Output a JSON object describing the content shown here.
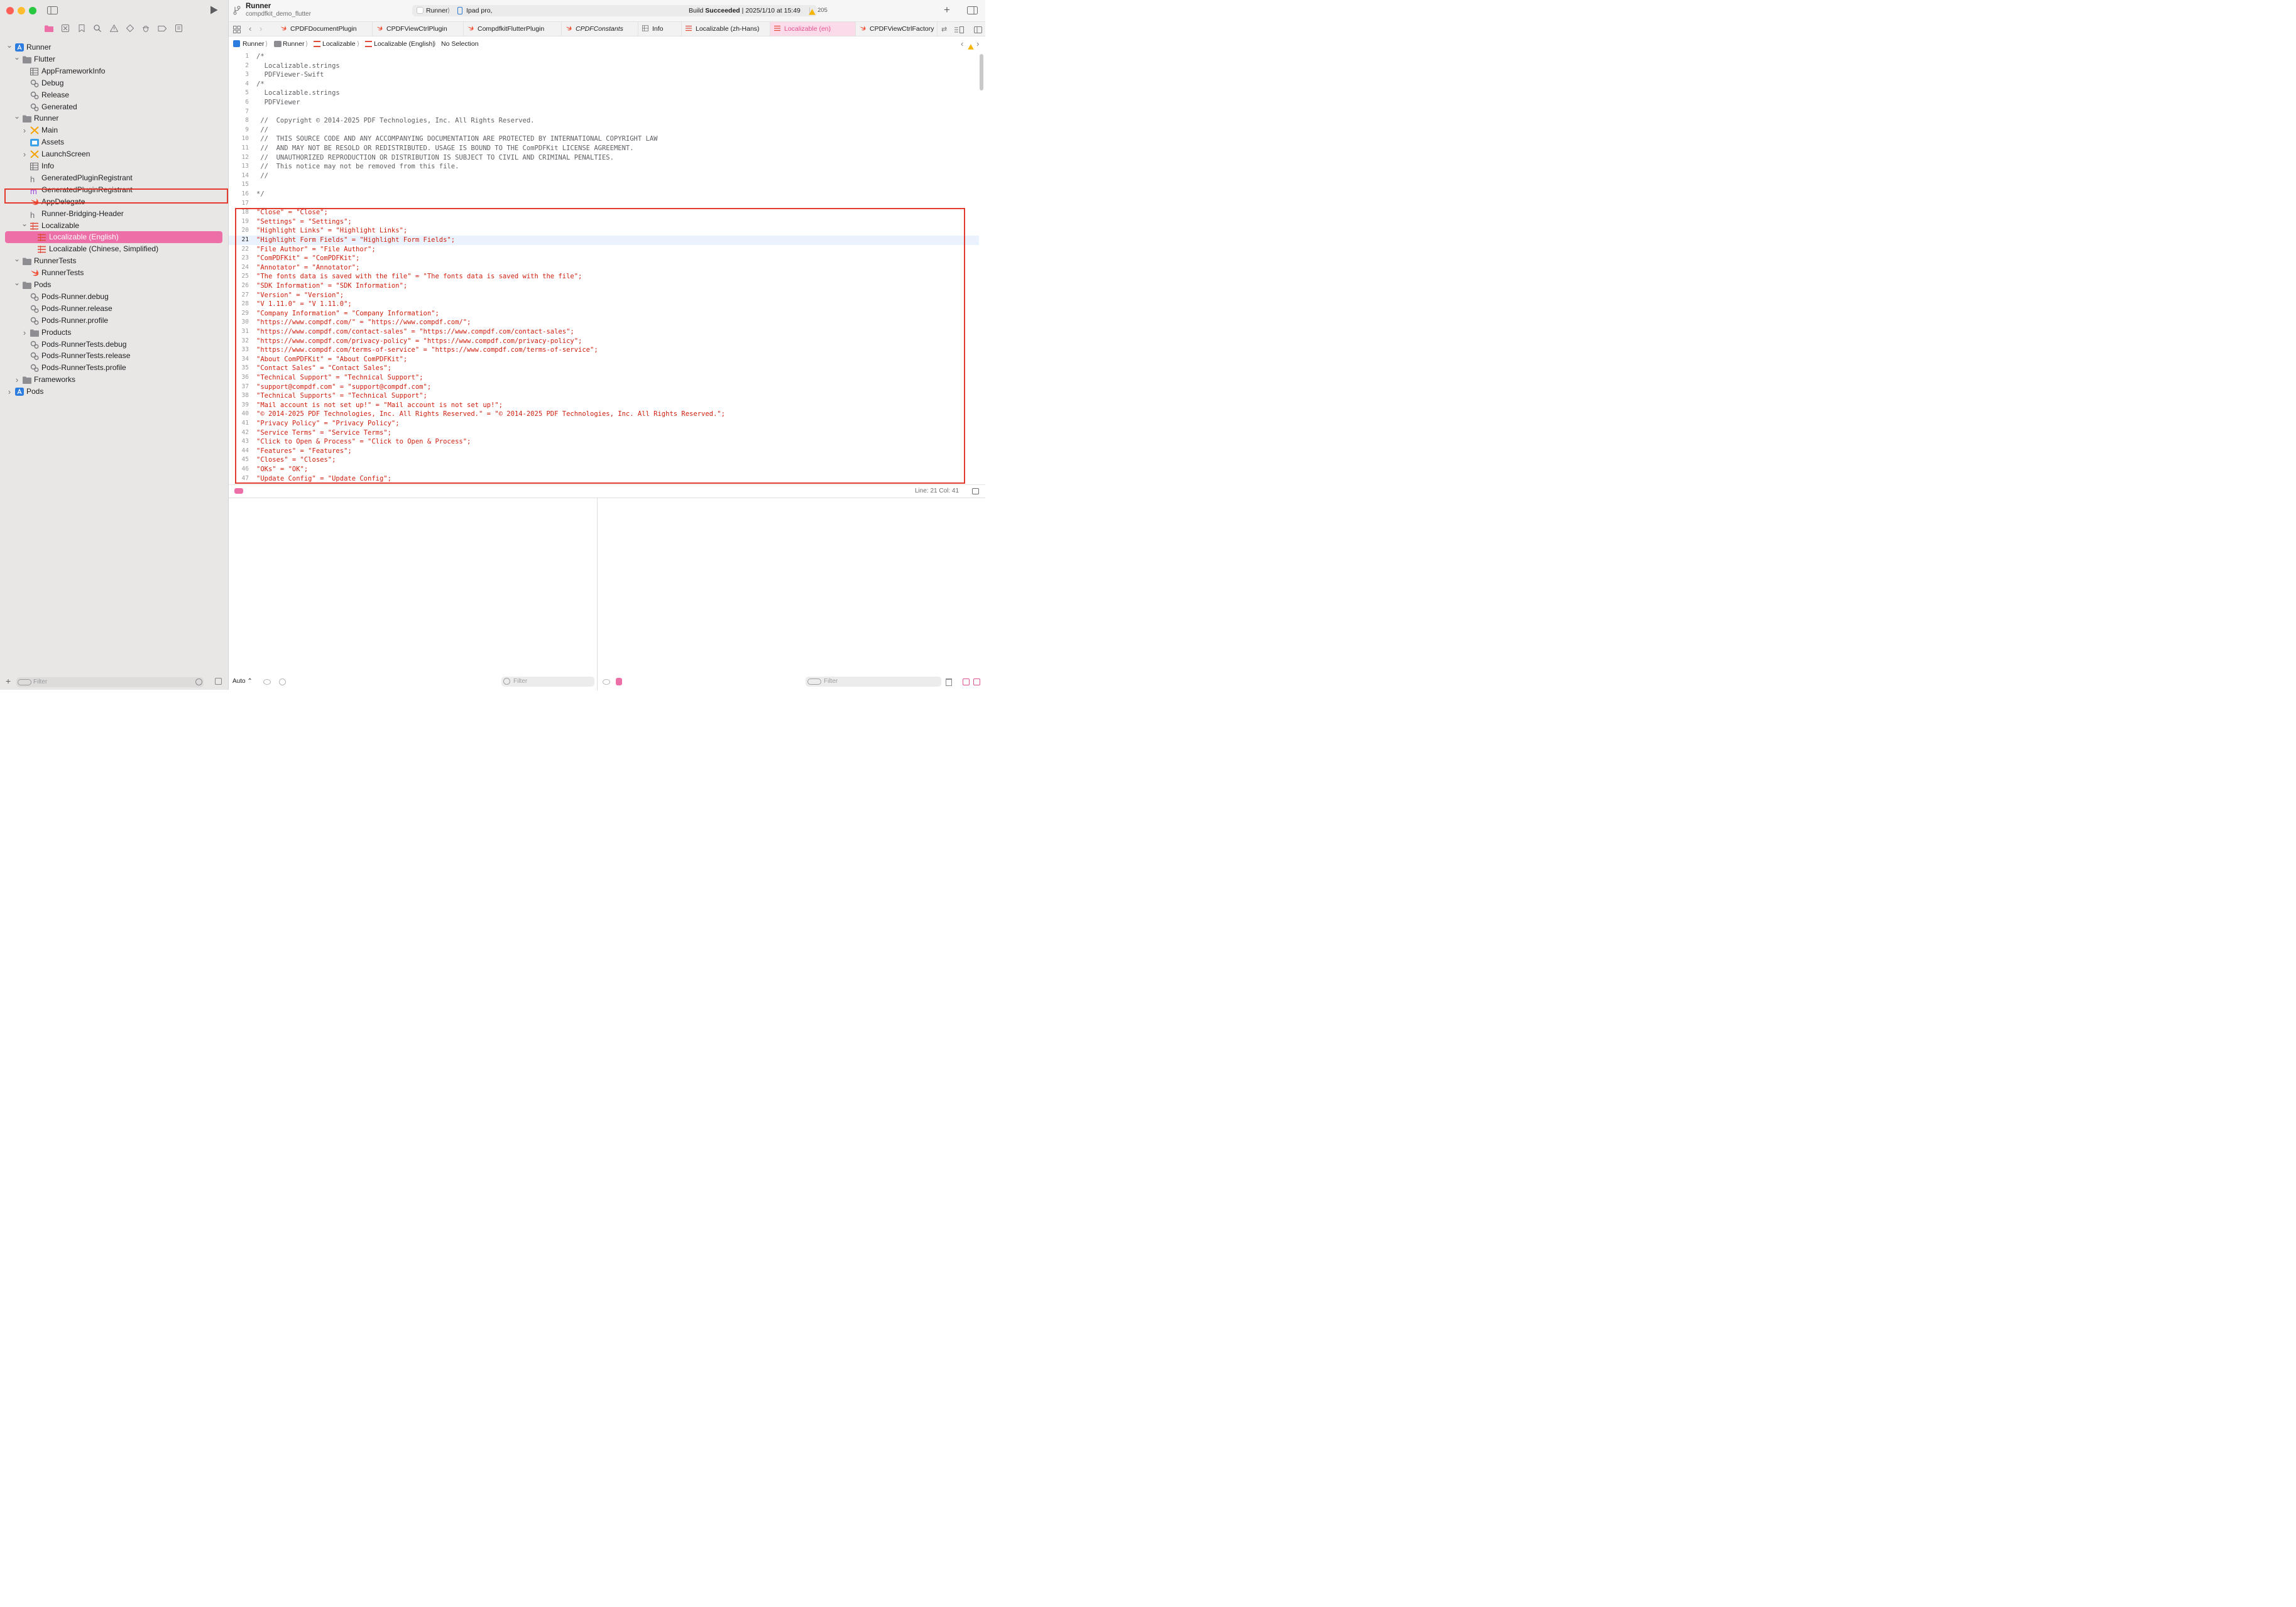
{
  "window": {
    "scheme_name": "Runner",
    "project_name": "compdfkit_demo_flutter",
    "destination_scheme": "Runner",
    "destination_device": "Ipad pro,",
    "build_status_prefix": "Build",
    "build_status_result": "Succeeded",
    "build_timestamp": "2025/1/10 at 15:49",
    "warning_count": "205"
  },
  "sidebar": {
    "filter_placeholder": "Filter",
    "tree": [
      {
        "label": "Runner",
        "icon": "xcode-project-icon"
      },
      {
        "label": "Flutter",
        "icon": "folder-icon"
      },
      {
        "label": "AppFrameworkInfo",
        "icon": "plist-icon"
      },
      {
        "label": "Debug",
        "icon": "xcconfig-icon"
      },
      {
        "label": "Release",
        "icon": "xcconfig-icon"
      },
      {
        "label": "Generated",
        "icon": "xcconfig-icon"
      },
      {
        "label": "Runner",
        "icon": "folder-icon"
      },
      {
        "label": "Main",
        "icon": "storyboard-icon"
      },
      {
        "label": "Assets",
        "icon": "asset-catalog-icon"
      },
      {
        "label": "LaunchScreen",
        "icon": "storyboard-icon"
      },
      {
        "label": "Info",
        "icon": "plist-icon"
      },
      {
        "label": "GeneratedPluginRegistrant",
        "icon": "header-file-icon"
      },
      {
        "label": "GeneratedPluginRegistrant",
        "icon": "objc-file-icon"
      },
      {
        "label": "AppDelegate",
        "icon": "swift-file-icon"
      },
      {
        "label": "Runner-Bridging-Header",
        "icon": "header-file-icon"
      },
      {
        "label": "Localizable",
        "icon": "strings-file-icon"
      },
      {
        "label": "Localizable (English)",
        "icon": "strings-file-icon"
      },
      {
        "label": "Localizable (Chinese, Simplified)",
        "icon": "strings-file-icon"
      },
      {
        "label": "RunnerTests",
        "icon": "folder-icon"
      },
      {
        "label": "RunnerTests",
        "icon": "swift-file-icon"
      },
      {
        "label": "Pods",
        "icon": "folder-icon"
      },
      {
        "label": "Pods-Runner.debug",
        "icon": "xcconfig-icon"
      },
      {
        "label": "Pods-Runner.release",
        "icon": "xcconfig-icon"
      },
      {
        "label": "Pods-Runner.profile",
        "icon": "xcconfig-icon"
      },
      {
        "label": "Products",
        "icon": "folder-icon"
      },
      {
        "label": "Pods-RunnerTests.debug",
        "icon": "xcconfig-icon"
      },
      {
        "label": "Pods-RunnerTests.release",
        "icon": "xcconfig-icon"
      },
      {
        "label": "Pods-RunnerTests.profile",
        "icon": "xcconfig-icon"
      },
      {
        "label": "Frameworks",
        "icon": "folder-icon"
      },
      {
        "label": "Pods",
        "icon": "xcode-project-icon"
      }
    ]
  },
  "tabs": [
    {
      "label": "CPDFDocumentPlugin",
      "icon": "swift-file-icon"
    },
    {
      "label": "CPDFViewCtrlPlugin",
      "icon": "swift-file-icon"
    },
    {
      "label": "CompdfkitFlutterPlugin",
      "icon": "swift-file-icon"
    },
    {
      "label": "CPDFConstants",
      "icon": "swift-file-icon"
    },
    {
      "label": "Info",
      "icon": "plist-icon"
    },
    {
      "label": "Localizable (zh-Hans)",
      "icon": "strings-file-icon"
    },
    {
      "label": "Localizable (en)",
      "icon": "strings-file-icon"
    },
    {
      "label": "CPDFViewCtrlFactory",
      "icon": "swift-file-icon"
    }
  ],
  "breadcrumb": [
    "Runner",
    "Runner",
    "Localizable",
    "Localizable (English)",
    "No Selection"
  ],
  "editor": {
    "lines": [
      {
        "n": "1",
        "text": "/*",
        "kind": "com"
      },
      {
        "n": "2",
        "text": "  Localizable.strings",
        "kind": "com"
      },
      {
        "n": "3",
        "text": "  PDFViewer-Swift",
        "kind": "com"
      },
      {
        "n": "4",
        "text": "/*",
        "kind": "com"
      },
      {
        "n": "5",
        "text": "  Localizable.strings",
        "kind": "com"
      },
      {
        "n": "6",
        "text": "  PDFViewer",
        "kind": "com"
      },
      {
        "n": "7",
        "text": "",
        "kind": "com"
      },
      {
        "n": "8",
        "text": " //  Copyright © 2014-2025 PDF Technologies, Inc. All Rights Reserved.",
        "kind": "com"
      },
      {
        "n": "9",
        "text": " //",
        "kind": "com"
      },
      {
        "n": "10",
        "text": " //  THIS SOURCE CODE AND ANY ACCOMPANYING DOCUMENTATION ARE PROTECTED BY INTERNATIONAL COPYRIGHT LAW",
        "kind": "com"
      },
      {
        "n": "11",
        "text": " //  AND MAY NOT BE RESOLD OR REDISTRIBUTED. USAGE IS BOUND TO THE ComPDFKit LICENSE AGREEMENT.",
        "kind": "com"
      },
      {
        "n": "12",
        "text": " //  UNAUTHORIZED REPRODUCTION OR DISTRIBUTION IS SUBJECT TO CIVIL AND CRIMINAL PENALTIES.",
        "kind": "com"
      },
      {
        "n": "13",
        "text": " //  This notice may not be removed from this file.",
        "kind": "com"
      },
      {
        "n": "14",
        "text": " //",
        "kind": "com"
      },
      {
        "n": "15",
        "text": "",
        "kind": "com"
      },
      {
        "n": "16",
        "text": "*/",
        "kind": "com"
      },
      {
        "n": "17",
        "text": "",
        "kind": "com"
      },
      {
        "n": "18",
        "text": "\"Close\" = \"Close\";",
        "kind": "str"
      },
      {
        "n": "19",
        "text": "\"Settings\" = \"Settings\";",
        "kind": "str"
      },
      {
        "n": "20",
        "text": "\"Highlight Links\" = \"Highlight Links\";",
        "kind": "str"
      },
      {
        "n": "21",
        "text": "\"Highlight Form Fields\" = \"Highlight Form Fields\";",
        "kind": "str"
      },
      {
        "n": "22",
        "text": "\"File Author\" = \"File Author\";",
        "kind": "str"
      },
      {
        "n": "23",
        "text": "\"ComPDFKit\" = \"ComPDFKit\";",
        "kind": "str"
      },
      {
        "n": "24",
        "text": "\"Annotator\" = \"Annotator\";",
        "kind": "str"
      },
      {
        "n": "25",
        "text": "\"The fonts data is saved with the file\" = \"The fonts data is saved with the file\";",
        "kind": "str"
      },
      {
        "n": "26",
        "text": "\"SDK Information\" = \"SDK Information\";",
        "kind": "str"
      },
      {
        "n": "27",
        "text": "\"Version\" = \"Version\";",
        "kind": "str"
      },
      {
        "n": "28",
        "text": "\"V 1.11.0\" = \"V 1.11.0\";",
        "kind": "str"
      },
      {
        "n": "29",
        "text": "\"Company Information\" = \"Company Information\";",
        "kind": "str"
      },
      {
        "n": "30",
        "text": "\"https://www.compdf.com/\" = \"https://www.compdf.com/\";",
        "kind": "str"
      },
      {
        "n": "31",
        "text": "\"https://www.compdf.com/contact-sales\" = \"https://www.compdf.com/contact-sales\";",
        "kind": "str"
      },
      {
        "n": "32",
        "text": "\"https://www.compdf.com/privacy-policy\" = \"https://www.compdf.com/privacy-policy\";",
        "kind": "str"
      },
      {
        "n": "33",
        "text": "\"https://www.compdf.com/terms-of-service\" = \"https://www.compdf.com/terms-of-service\";",
        "kind": "str"
      },
      {
        "n": "34",
        "text": "\"About ComPDFKit\" = \"About ComPDFKit\";",
        "kind": "str"
      },
      {
        "n": "35",
        "text": "\"Contact Sales\" = \"Contact Sales\";",
        "kind": "str"
      },
      {
        "n": "36",
        "text": "\"Technical Support\" = \"Technical Support\";",
        "kind": "str"
      },
      {
        "n": "37",
        "text": "\"support@compdf.com\" = \"support@compdf.com\";",
        "kind": "str"
      },
      {
        "n": "38",
        "text": "\"Technical Supports\" = \"Technical Support\";",
        "kind": "str"
      },
      {
        "n": "39",
        "text": "\"Mail account is not set up!\" = \"Mail account is not set up!\";",
        "kind": "str"
      },
      {
        "n": "40",
        "text": "\"© 2014-2025 PDF Technologies, Inc. All Rights Reserved.\" = \"© 2014-2025 PDF Technologies, Inc. All Rights Reserved.\";",
        "kind": "str"
      },
      {
        "n": "41",
        "text": "\"Privacy Policy\" = \"Privacy Policy\";",
        "kind": "str"
      },
      {
        "n": "42",
        "text": "\"Service Terms\" = \"Service Terms\";",
        "kind": "str"
      },
      {
        "n": "43",
        "text": "\"Click to Open & Process\" = \"Click to Open & Process\";",
        "kind": "str"
      },
      {
        "n": "44",
        "text": "\"Features\" = \"Features\";",
        "kind": "str"
      },
      {
        "n": "45",
        "text": "\"Closes\" = \"Closes\";",
        "kind": "str"
      },
      {
        "n": "46",
        "text": "\"OKs\" = \"OK\";",
        "kind": "str"
      },
      {
        "n": "47",
        "text": "\"Update Config\" = \"Update Config\";",
        "kind": "str"
      }
    ],
    "cursor": "Line: 21  Col: 41"
  },
  "debug": {
    "scope": "Auto ⌃",
    "left_filter_placeholder": "Filter",
    "right_filter_placeholder": "Filter"
  },
  "colors": {
    "accent_pink": "#ec6fa8",
    "annotation_red": "#e23b2e",
    "string_red": "#d0200f"
  }
}
